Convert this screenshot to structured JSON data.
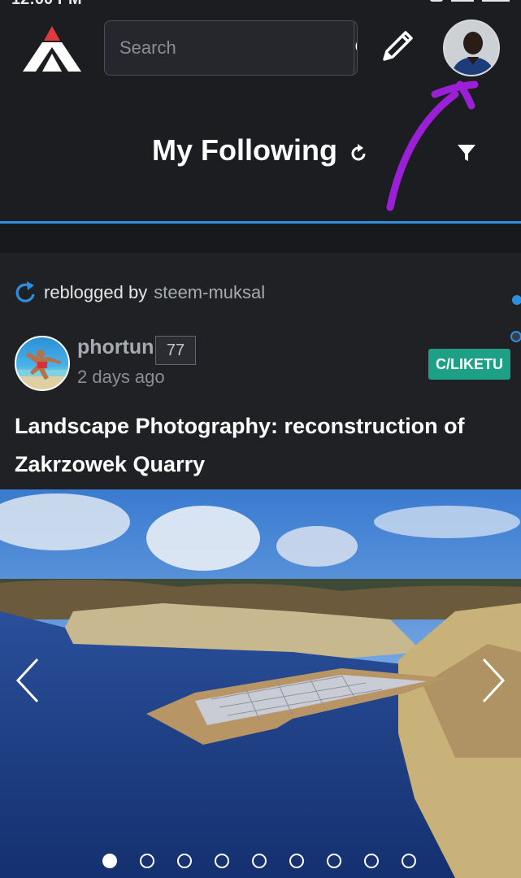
{
  "status_bar": {
    "time": "12:00 PM"
  },
  "header": {
    "logo_icon": "peakd-logo-icon",
    "search": {
      "placeholder": "Search"
    },
    "accent_color": "#e03a3e"
  },
  "page": {
    "title": "My Following"
  },
  "post": {
    "reblog_label": "reblogged by",
    "reblog_user": "steem-muksal",
    "author": "phortun",
    "reputation": "77",
    "time_ago": "2 days ago",
    "community": "C/LIKETU",
    "title": "Landscape Photography: reconstruction of Zakrzowek Quarry",
    "carousel": {
      "total_images": 9,
      "active_index": 0
    }
  },
  "colors": {
    "background": "#1b1d21",
    "card": "#1f2125",
    "accent_blue": "#2e8fe0",
    "community_tag": "#1ea087",
    "annotation": "#9b1fd6"
  }
}
